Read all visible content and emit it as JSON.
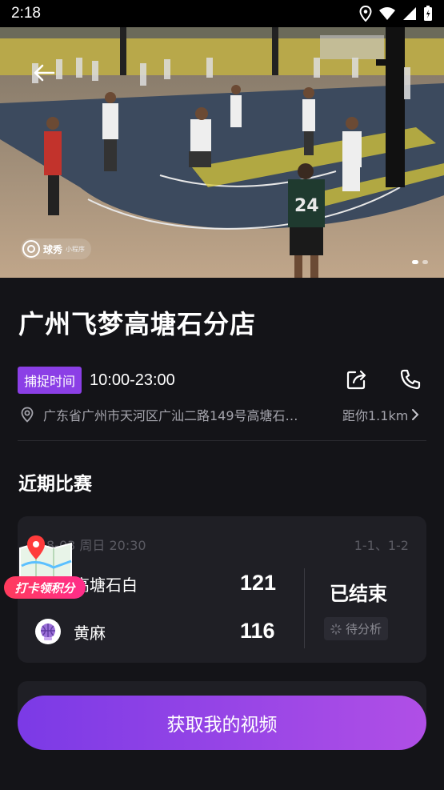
{
  "status_bar": {
    "time": "2:18"
  },
  "hero": {
    "watermark_name": "球秀",
    "watermark_sub": "小程序",
    "player_number": "24",
    "carousel_pages": 2,
    "carousel_active": 1
  },
  "store": {
    "name": "广州飞梦高塘石分店",
    "hours_tag": "捕捉时间",
    "hours": "10:00-23:00",
    "address": "广东省广州市天河区广汕二路149号高塘石…",
    "distance": "距你1.1km"
  },
  "recent": {
    "title": "近期比赛",
    "match": {
      "date": "8-03 周日 20:30",
      "courts": "1-1、1-2",
      "team1": {
        "name": "高塘石白",
        "score": "121"
      },
      "team2": {
        "name": "黄麻",
        "score": "116"
      },
      "status": "已结束",
      "analysis": "待分析"
    }
  },
  "checkin_badge": "打卡领积分",
  "cta": "获取我的视频",
  "colors": {
    "accent": "#8b3fe6",
    "background": "#141418",
    "card": "#1f1f25"
  },
  "icons": [
    "back-arrow-icon",
    "share-icon",
    "phone-icon",
    "location-pin-icon",
    "chevron-right-icon",
    "loading-icon",
    "map-pin-icon"
  ]
}
